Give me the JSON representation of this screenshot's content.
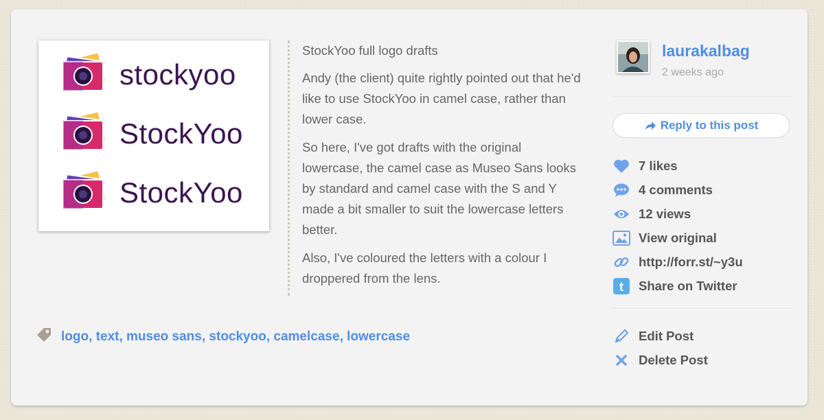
{
  "post": {
    "title": "StockYoo full logo drafts",
    "paragraphs": [
      "Andy (the client) quite rightly pointed out that he'd like to use StockYoo in camel case, rather than lower case.",
      "So here, I've got drafts with the original lowercase, the camel case as Museo Sans looks by standard and camel case with the S and Y made a bit smaller to suit the lowercase letters better.",
      "Also, I've coloured the letters with a colour I droppered from the lens."
    ],
    "image": {
      "logo_variants": [
        "stockyoo",
        "StockYoo",
        "StockYoo"
      ],
      "colors": {
        "wordmark": "#3a1550"
      }
    }
  },
  "tags": [
    "logo",
    "text",
    "museo sans",
    "stockyoo",
    "camelcase",
    "lowercase"
  ],
  "author": {
    "name": "laurakalbag",
    "time_ago": "2 weeks ago"
  },
  "reply_button": "Reply to this post",
  "stats": {
    "likes": "7 likes",
    "comments": "4 comments",
    "views": "12 views",
    "view_original": "View original",
    "short_link": "http://forr.st/~y3u",
    "share_twitter": "Share on Twitter"
  },
  "actions": {
    "edit": "Edit Post",
    "delete": "Delete Post"
  },
  "colors": {
    "link": "#4f8ee0",
    "stat_text": "#555555",
    "body_text": "#666666"
  }
}
